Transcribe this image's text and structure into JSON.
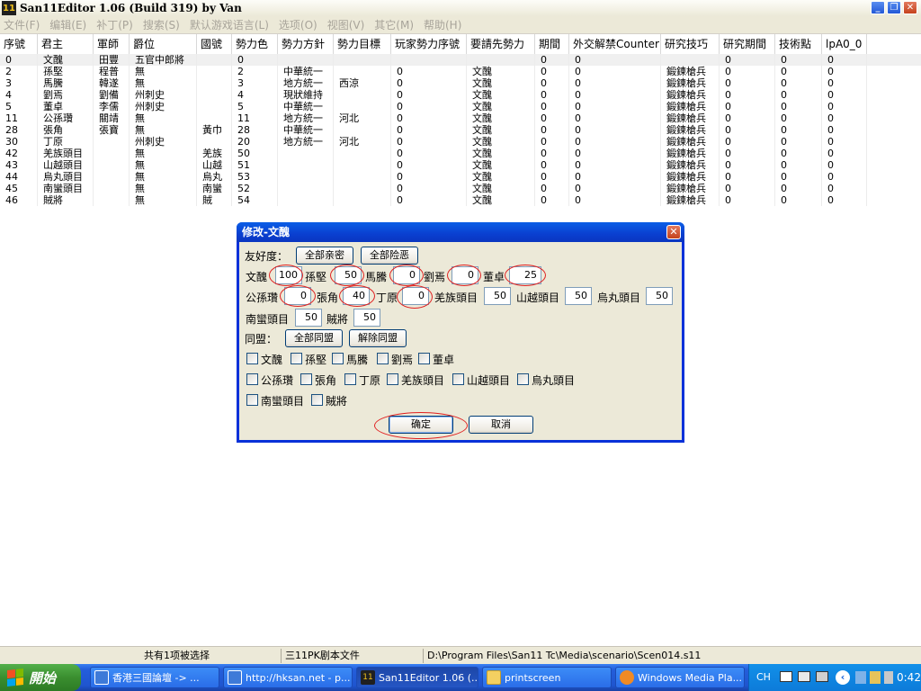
{
  "window": {
    "title": "San11Editor 1.06 (Build 319) by Van",
    "app_icon_text": "11",
    "controls": {
      "minimize": "_",
      "maximize": "❐",
      "close": "✕"
    }
  },
  "menu": [
    "文件(F)",
    "编辑(E)",
    "补丁(P)",
    "搜索(S)",
    "默认游戏语言(L)",
    "选项(O)",
    "视图(V)",
    "其它(M)",
    "帮助(H)"
  ],
  "table": {
    "columns": [
      "序號",
      "君主",
      "軍師",
      "爵位",
      "國號",
      "勢力色",
      "勢力方針",
      "勢力目標",
      "玩家勢力序號",
      "要請先勢力",
      "期間",
      "外交解禁Counter",
      "研究技巧",
      "研究期間",
      "技術點",
      "lpA0_0"
    ],
    "rows": [
      [
        "0",
        "文醜",
        "田豐",
        "五官中郎將",
        "",
        "0",
        "",
        "",
        "",
        "",
        "0",
        "0",
        "",
        "0",
        "0",
        "0"
      ],
      [
        "2",
        "孫堅",
        "程普",
        "無",
        "",
        "2",
        "中華統一",
        "",
        "0",
        "文醜",
        "0",
        "0",
        "鍛鍊槍兵",
        "0",
        "0",
        "0"
      ],
      [
        "3",
        "馬騰",
        "韓遂",
        "無",
        "",
        "3",
        "地方統一",
        "西涼",
        "0",
        "文醜",
        "0",
        "0",
        "鍛鍊槍兵",
        "0",
        "0",
        "0"
      ],
      [
        "4",
        "劉焉",
        "劉備",
        "州刺史",
        "",
        "4",
        "現狀維持",
        "",
        "0",
        "文醜",
        "0",
        "0",
        "鍛鍊槍兵",
        "0",
        "0",
        "0"
      ],
      [
        "5",
        "董卓",
        "李儒",
        "州刺史",
        "",
        "5",
        "中華統一",
        "",
        "0",
        "文醜",
        "0",
        "0",
        "鍛鍊槍兵",
        "0",
        "0",
        "0"
      ],
      [
        "11",
        "公孫瓚",
        "關靖",
        "無",
        "",
        "11",
        "地方統一",
        "河北",
        "0",
        "文醜",
        "0",
        "0",
        "鍛鍊槍兵",
        "0",
        "0",
        "0"
      ],
      [
        "28",
        "張角",
        "張寶",
        "無",
        "黃巾",
        "28",
        "中華統一",
        "",
        "0",
        "文醜",
        "0",
        "0",
        "鍛鍊槍兵",
        "0",
        "0",
        "0"
      ],
      [
        "30",
        "丁原",
        "",
        "州刺史",
        "",
        "20",
        "地方統一",
        "河北",
        "0",
        "文醜",
        "0",
        "0",
        "鍛鍊槍兵",
        "0",
        "0",
        "0"
      ],
      [
        "42",
        "羌族頭目",
        "",
        "無",
        "羌族",
        "50",
        "",
        "",
        "0",
        "文醜",
        "0",
        "0",
        "鍛鍊槍兵",
        "0",
        "0",
        "0"
      ],
      [
        "43",
        "山越頭目",
        "",
        "無",
        "山越",
        "51",
        "",
        "",
        "0",
        "文醜",
        "0",
        "0",
        "鍛鍊槍兵",
        "0",
        "0",
        "0"
      ],
      [
        "44",
        "烏丸頭目",
        "",
        "無",
        "烏丸",
        "53",
        "",
        "",
        "0",
        "文醜",
        "0",
        "0",
        "鍛鍊槍兵",
        "0",
        "0",
        "0"
      ],
      [
        "45",
        "南蠻頭目",
        "",
        "無",
        "南蠻",
        "52",
        "",
        "",
        "0",
        "文醜",
        "0",
        "0",
        "鍛鍊槍兵",
        "0",
        "0",
        "0"
      ],
      [
        "46",
        "賊將",
        "",
        "無",
        "賊",
        "54",
        "",
        "",
        "0",
        "文醜",
        "0",
        "0",
        "鍛鍊槍兵",
        "0",
        "0",
        "0"
      ]
    ]
  },
  "dialog": {
    "title": "修改-文醜",
    "close": "✕",
    "friendship_label": "友好度：",
    "all_friendly": "全部亲密",
    "all_hostile": "全部险恶",
    "friendship": [
      {
        "name": "文醜",
        "value": "100"
      },
      {
        "name": "孫堅",
        "value": "50"
      },
      {
        "name": "馬騰",
        "value": "0"
      },
      {
        "name": "劉焉",
        "value": "0"
      },
      {
        "name": "董卓",
        "value": "25"
      },
      {
        "name": "公孫瓚",
        "value": "0"
      },
      {
        "name": "張角",
        "value": "40"
      },
      {
        "name": "丁原",
        "value": "0"
      },
      {
        "name": "羌族頭目",
        "value": "50"
      },
      {
        "name": "山越頭目",
        "value": "50"
      },
      {
        "name": "烏丸頭目",
        "value": "50"
      },
      {
        "name": "南蠻頭目",
        "value": "50"
      },
      {
        "name": "賊將",
        "value": "50"
      }
    ],
    "alliance_label": "同盟：",
    "all_ally": "全部同盟",
    "dissolve_ally": "解除同盟",
    "alliance": [
      "文醜",
      "孫堅",
      "馬騰",
      "劉焉",
      "董卓",
      "公孫瓚",
      "張角",
      "丁原",
      "羌族頭目",
      "山越頭目",
      "烏丸頭目",
      "南蠻頭目",
      "賊將"
    ],
    "ok": "确定",
    "cancel": "取消"
  },
  "status": {
    "selected": "共有1项被选择",
    "filetype": "三11PK剧本文件",
    "path": "D:\\Program Files\\San11 Tc\\Media\\scenario\\Scen014.s11"
  },
  "taskbar": {
    "start": "開始",
    "tasks": [
      "香港三國論壇 -> ...",
      "http://hksan.net - p...",
      "San11Editor 1.06 (...",
      "printscreen",
      "Windows Media Pla..."
    ],
    "lang": "CH",
    "clock": "0:42"
  },
  "colors": {
    "accent": "#0a3fd0",
    "highlight": "#e02020"
  }
}
